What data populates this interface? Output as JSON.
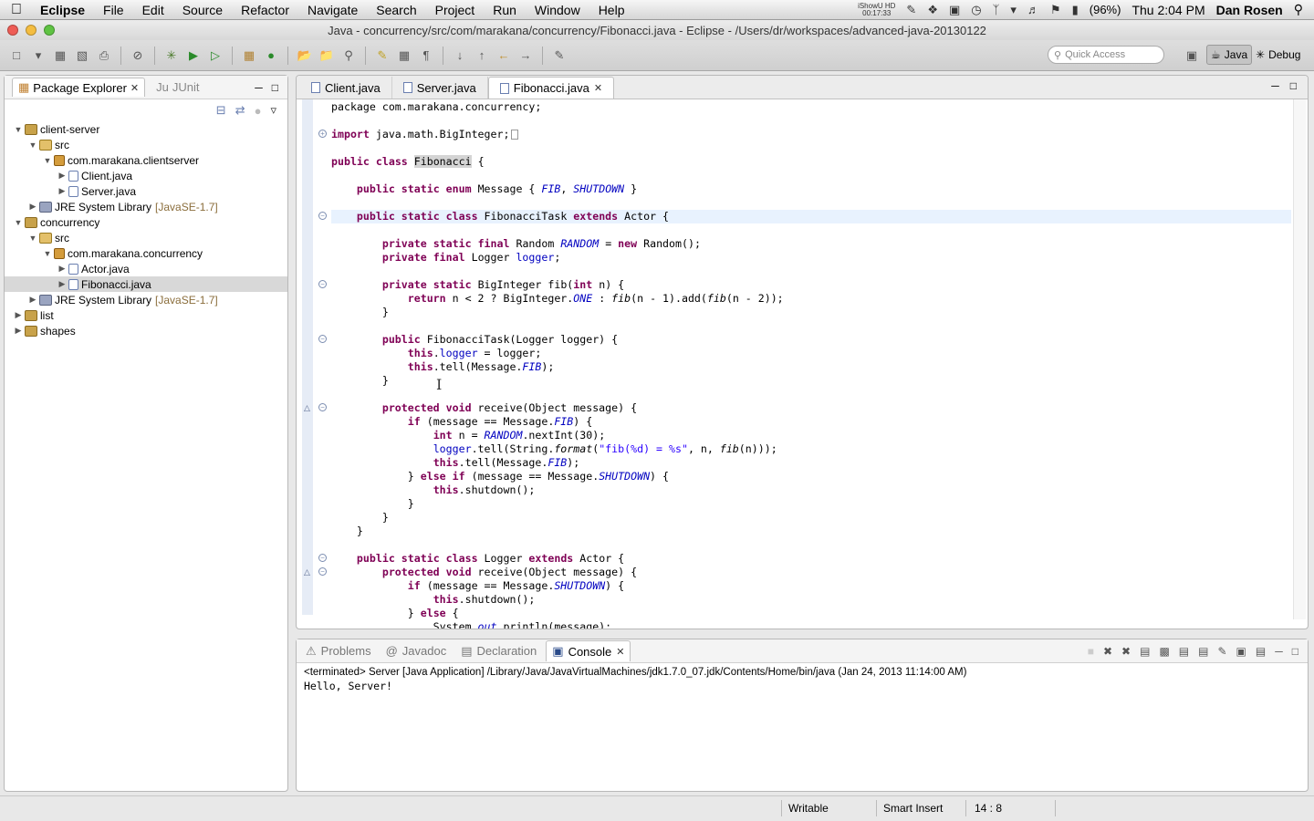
{
  "menubar": {
    "app": "Eclipse",
    "items": [
      "File",
      "Edit",
      "Source",
      "Refactor",
      "Navigate",
      "Search",
      "Project",
      "Run",
      "Window",
      "Help"
    ],
    "recorder_name": "iShowU HD",
    "recorder_time": "00:17:33",
    "battery": "(96%)",
    "clock": "Thu 2:04 PM",
    "user": "Dan Rosen"
  },
  "window": {
    "title": "Java - concurrency/src/com/marakana/concurrency/Fibonacci.java - Eclipse - /Users/dr/workspaces/advanced-java-20130122"
  },
  "toolbar": {
    "quick_access_placeholder": "Quick Access",
    "perspectives": [
      "Java",
      "Debug"
    ]
  },
  "package_explorer": {
    "tabs": [
      "Package Explorer",
      "JUnit"
    ],
    "tree": [
      {
        "label": "client-server",
        "kind": "proj",
        "level": 0,
        "twisty": "open"
      },
      {
        "label": "src",
        "kind": "src",
        "level": 1,
        "twisty": "open"
      },
      {
        "label": "com.marakana.clientserver",
        "kind": "pkg",
        "level": 2,
        "twisty": "open"
      },
      {
        "label": "Client.java",
        "kind": "java",
        "level": 3,
        "twisty": "closed"
      },
      {
        "label": "Server.java",
        "kind": "java",
        "level": 3,
        "twisty": "closed"
      },
      {
        "label": "JRE System Library",
        "suffix": "[JavaSE-1.7]",
        "kind": "lib",
        "level": 1,
        "twisty": "closed"
      },
      {
        "label": "concurrency",
        "kind": "proj",
        "level": 0,
        "twisty": "open"
      },
      {
        "label": "src",
        "kind": "src",
        "level": 1,
        "twisty": "open"
      },
      {
        "label": "com.marakana.concurrency",
        "kind": "pkg",
        "level": 2,
        "twisty": "open"
      },
      {
        "label": "Actor.java",
        "kind": "java",
        "level": 3,
        "twisty": "closed"
      },
      {
        "label": "Fibonacci.java",
        "kind": "java",
        "level": 3,
        "twisty": "closed",
        "selected": true
      },
      {
        "label": "JRE System Library",
        "suffix": "[JavaSE-1.7]",
        "kind": "lib",
        "level": 1,
        "twisty": "closed"
      },
      {
        "label": "list",
        "kind": "proj",
        "level": 0,
        "twisty": "closed"
      },
      {
        "label": "shapes",
        "kind": "proj",
        "level": 0,
        "twisty": "closed"
      }
    ]
  },
  "editor": {
    "tabs": [
      "Client.java",
      "Server.java",
      "Fibonacci.java"
    ],
    "active_tab": "Fibonacci.java",
    "lines": [
      [
        [
          "",
          "package com.marakana.concurrency;"
        ]
      ],
      [],
      [
        [
          "kw",
          "import"
        ],
        [
          "",
          " java.math.BigInteger;"
        ]
      ],
      [],
      [
        [
          "kw",
          "public"
        ],
        [
          "",
          " "
        ],
        [
          "kw",
          "class"
        ],
        [
          "",
          " "
        ],
        [
          "occ",
          "Fibonacci"
        ],
        [
          "",
          " {"
        ]
      ],
      [],
      [
        [
          "",
          "    "
        ],
        [
          "kw",
          "public"
        ],
        [
          "",
          " "
        ],
        [
          "kw",
          "static"
        ],
        [
          "",
          " "
        ],
        [
          "kw",
          "enum"
        ],
        [
          "",
          " Message { "
        ],
        [
          "fld",
          "FIB"
        ],
        [
          "",
          ", "
        ],
        [
          "fld",
          "SHUTDOWN"
        ],
        [
          "",
          " }"
        ]
      ],
      [],
      [
        [
          "",
          "    "
        ],
        [
          "kw",
          "public"
        ],
        [
          "",
          " "
        ],
        [
          "kw",
          "static"
        ],
        [
          "",
          " "
        ],
        [
          "kw",
          "class"
        ],
        [
          "",
          " FibonacciTask "
        ],
        [
          "kw",
          "extends"
        ],
        [
          "",
          " Actor {"
        ]
      ],
      [],
      [
        [
          "",
          "        "
        ],
        [
          "kw",
          "private"
        ],
        [
          "",
          " "
        ],
        [
          "kw",
          "static"
        ],
        [
          "",
          " "
        ],
        [
          "kw",
          "final"
        ],
        [
          "",
          " Random "
        ],
        [
          "fld",
          "RANDOM"
        ],
        [
          "",
          " = "
        ],
        [
          "kw",
          "new"
        ],
        [
          "",
          " Random();"
        ]
      ],
      [
        [
          "",
          "        "
        ],
        [
          "kw",
          "private"
        ],
        [
          "",
          " "
        ],
        [
          "kw",
          "final"
        ],
        [
          "",
          " Logger "
        ],
        [
          "fld2",
          "logger"
        ],
        [
          "",
          ";"
        ]
      ],
      [],
      [
        [
          "",
          "        "
        ],
        [
          "kw",
          "private"
        ],
        [
          "",
          " "
        ],
        [
          "kw",
          "static"
        ],
        [
          "",
          " BigInteger fib("
        ],
        [
          "kw",
          "int"
        ],
        [
          "",
          " n) {"
        ]
      ],
      [
        [
          "",
          "            "
        ],
        [
          "kw",
          "return"
        ],
        [
          "",
          " n < 2 ? BigInteger."
        ],
        [
          "fld",
          "ONE"
        ],
        [
          "",
          " : "
        ],
        [
          "it",
          "fib"
        ],
        [
          "",
          "(n - 1).add("
        ],
        [
          "it",
          "fib"
        ],
        [
          "",
          "(n - 2));"
        ]
      ],
      [
        [
          "",
          "        }"
        ]
      ],
      [],
      [
        [
          "",
          "        "
        ],
        [
          "kw",
          "public"
        ],
        [
          "",
          " FibonacciTask(Logger logger) {"
        ]
      ],
      [
        [
          "",
          "            "
        ],
        [
          "kw",
          "this"
        ],
        [
          "",
          "."
        ],
        [
          "fld2",
          "logger"
        ],
        [
          "",
          " = logger;"
        ]
      ],
      [
        [
          "",
          "            "
        ],
        [
          "kw",
          "this"
        ],
        [
          "",
          ".tell(Message."
        ],
        [
          "fld",
          "FIB"
        ],
        [
          "",
          ");"
        ]
      ],
      [
        [
          "",
          "        }"
        ]
      ],
      [],
      [
        [
          "",
          "        "
        ],
        [
          "kw",
          "protected"
        ],
        [
          "",
          " "
        ],
        [
          "kw",
          "void"
        ],
        [
          "",
          " receive(Object message) {"
        ]
      ],
      [
        [
          "",
          "            "
        ],
        [
          "kw",
          "if"
        ],
        [
          "",
          " (message == Message."
        ],
        [
          "fld",
          "FIB"
        ],
        [
          "",
          ") {"
        ]
      ],
      [
        [
          "",
          "                "
        ],
        [
          "kw",
          "int"
        ],
        [
          "",
          " n = "
        ],
        [
          "fld",
          "RANDOM"
        ],
        [
          "",
          ".nextInt(30);"
        ]
      ],
      [
        [
          "",
          "                "
        ],
        [
          "fld2",
          "logger"
        ],
        [
          "",
          ".tell(String."
        ],
        [
          "it",
          "format"
        ],
        [
          "",
          "("
        ],
        [
          "str",
          "\"fib(%d) = %s\""
        ],
        [
          "",
          ", n, "
        ],
        [
          "it",
          "fib"
        ],
        [
          "",
          "(n)));"
        ]
      ],
      [
        [
          "",
          "                "
        ],
        [
          "kw",
          "this"
        ],
        [
          "",
          ".tell(Message."
        ],
        [
          "fld",
          "FIB"
        ],
        [
          "",
          ");"
        ]
      ],
      [
        [
          "",
          "            } "
        ],
        [
          "kw",
          "else"
        ],
        [
          "",
          " "
        ],
        [
          "kw",
          "if"
        ],
        [
          "",
          " (message == Message."
        ],
        [
          "fld",
          "SHUTDOWN"
        ],
        [
          "",
          ") {"
        ]
      ],
      [
        [
          "",
          "                "
        ],
        [
          "kw",
          "this"
        ],
        [
          "",
          ".shutdown();"
        ]
      ],
      [
        [
          "",
          "            }"
        ]
      ],
      [
        [
          "",
          "        }"
        ]
      ],
      [
        [
          "",
          "    }"
        ]
      ],
      [],
      [
        [
          "",
          "    "
        ],
        [
          "kw",
          "public"
        ],
        [
          "",
          " "
        ],
        [
          "kw",
          "static"
        ],
        [
          "",
          " "
        ],
        [
          "kw",
          "class"
        ],
        [
          "",
          " Logger "
        ],
        [
          "kw",
          "extends"
        ],
        [
          "",
          " Actor {"
        ]
      ],
      [
        [
          "",
          "        "
        ],
        [
          "kw",
          "protected"
        ],
        [
          "",
          " "
        ],
        [
          "kw",
          "void"
        ],
        [
          "",
          " receive(Object message) {"
        ]
      ],
      [
        [
          "",
          "            "
        ],
        [
          "kw",
          "if"
        ],
        [
          "",
          " (message == Message."
        ],
        [
          "fld",
          "SHUTDOWN"
        ],
        [
          "",
          ") {"
        ]
      ],
      [
        [
          "",
          "                "
        ],
        [
          "kw",
          "this"
        ],
        [
          "",
          ".shutdown();"
        ]
      ],
      [
        [
          "",
          "            } "
        ],
        [
          "kw",
          "else"
        ],
        [
          "",
          " {"
        ]
      ],
      [
        [
          "",
          "                System."
        ],
        [
          "fld",
          "out"
        ],
        [
          "",
          ".println(message);"
        ]
      ]
    ]
  },
  "console": {
    "tabs": [
      "Problems",
      "Javadoc",
      "Declaration",
      "Console"
    ],
    "active_tab": "Console",
    "header": "<terminated> Server [Java Application] /Library/Java/JavaVirtualMachines/jdk1.7.0_07.jdk/Contents/Home/bin/java (Jan 24, 2013 11:14:00 AM)",
    "output": "Hello, Server!"
  },
  "statusbar": {
    "writable": "Writable",
    "insert_mode": "Smart Insert",
    "position": "14 : 8"
  }
}
